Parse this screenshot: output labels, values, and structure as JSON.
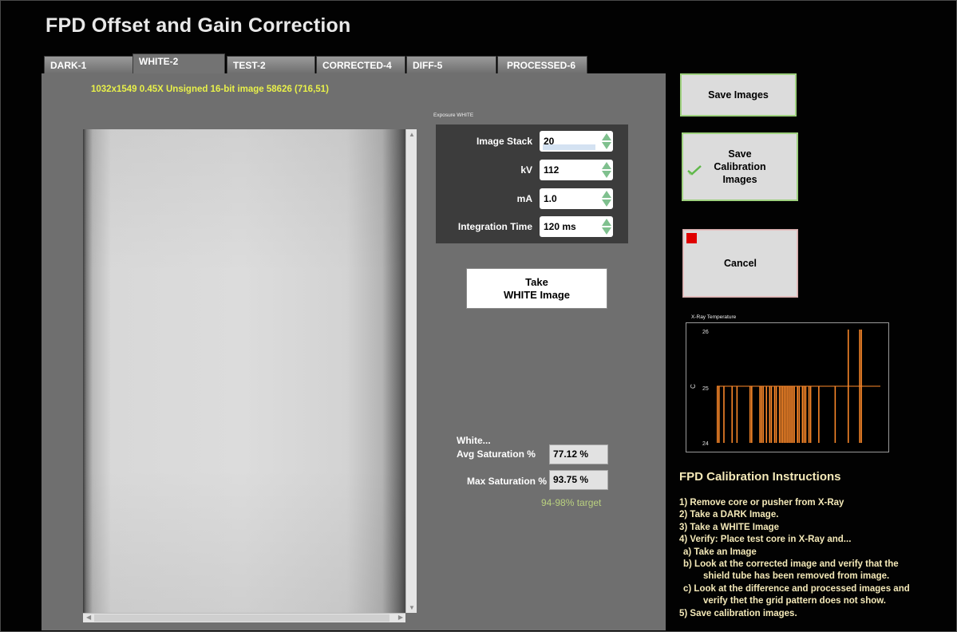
{
  "title": "FPD Offset and Gain Correction",
  "tabs": [
    {
      "label": "DARK-1",
      "active": false
    },
    {
      "label": "WHITE-2",
      "active": true
    },
    {
      "label": "TEST-2",
      "active": false
    },
    {
      "label": "CORRECTED-4",
      "active": false
    },
    {
      "label": "DIFF-5",
      "active": false
    },
    {
      "label": "PROCESSED-6",
      "active": false
    }
  ],
  "image_info": "1032x1549 0.45X Unsigned 16-bit image 58626   (716,51)",
  "exposure": {
    "caption": "Exposure WHITE",
    "fields": [
      {
        "label": "Image Stack",
        "value": "20"
      },
      {
        "label": "kV",
        "value": "112"
      },
      {
        "label": "mA",
        "value": "1.0"
      },
      {
        "label": "Integration Time",
        "value": "120 ms"
      }
    ]
  },
  "take_button": "Take\nWHITE Image",
  "saturation": {
    "title": "White...",
    "avg_label": "Avg Saturation %",
    "avg_value": "77.12 %",
    "max_label": "Max Saturation %",
    "max_value": "93.75 %",
    "target": "94-98% target"
  },
  "buttons": {
    "save_images": "Save Images",
    "save_calibration": "Save\nCalibration\nImages",
    "cancel": "Cancel"
  },
  "temperature_chart": {
    "caption": "X-Ray Temperature",
    "ylabel": "C",
    "ticks": [
      "26",
      "25",
      "24"
    ]
  },
  "chart_data": {
    "type": "bar",
    "ylabel": "C",
    "ylim": [
      24,
      26
    ],
    "yticks": [
      24,
      25,
      26
    ],
    "grid": false,
    "legend": "none",
    "bar_color": "#ff8a2a",
    "values": [
      25,
      25,
      24,
      24,
      25,
      24,
      24,
      24,
      24,
      25,
      24,
      24,
      25,
      24,
      24,
      24,
      24,
      24,
      24,
      24,
      25,
      25,
      24,
      24,
      24,
      24,
      25,
      25,
      25,
      24,
      25,
      24,
      25,
      25,
      24,
      25,
      25,
      24,
      25,
      25,
      25,
      25,
      25,
      25,
      25,
      25,
      25,
      25,
      24,
      25,
      25,
      24,
      25,
      25,
      25,
      24,
      25,
      25,
      24,
      24,
      24,
      24,
      25,
      24,
      24,
      24,
      24,
      24,
      24,
      24,
      24,
      24,
      25,
      24,
      24,
      24,
      24,
      24,
      24,
      24,
      26,
      24,
      24,
      24,
      24,
      24,
      24,
      26,
      26,
      24,
      24,
      24,
      24,
      24,
      24,
      24,
      24,
      24,
      24,
      24
    ]
  },
  "instructions": {
    "title": "FPD Calibration Instructions",
    "lines": [
      "1) Remove core or pusher from X-Ray",
      "2) Take a DARK Image.",
      "3) Take a WHITE Image",
      "4) Verify: Place test core in X-Ray and...",
      "a) Take an Image",
      "b)  Look at the corrected image and verify that the",
      "shield tube has been removed from image.",
      "c) Look at the difference and processed images and",
      "verify thet the grid pattern does not show.",
      "5) Save calibration images."
    ]
  },
  "colors": {
    "accent_green": "#9fd17f",
    "info_yellow": "#e8f04a",
    "instruction_text": "#f4e9b8",
    "stop_red": "#e00000",
    "chart_orange": "#ff8a2a"
  },
  "icons": [
    "check-icon",
    "stop-icon",
    "spin-up-icon",
    "spin-down-icon",
    "scroll-arrow-icon"
  ]
}
